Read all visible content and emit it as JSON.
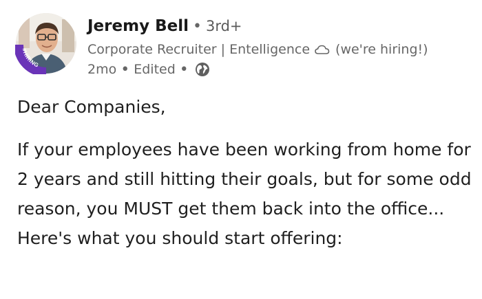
{
  "author": {
    "name": "Jeremy Bell",
    "degree": "3rd+",
    "headline": "Corporate Recruiter | Entelligence",
    "headline_suffix": "(we're hiring!)",
    "time": "2mo",
    "edited": "Edited",
    "avatar_badge": "#HIRING"
  },
  "post": {
    "greeting": "Dear Companies,",
    "paragraph": "If your employees have been working from home for 2 years and still hitting their goals, but for some odd reason, you MUST get them back into the office... Here's what you should start offering:"
  },
  "colors": {
    "hiring_ring": "#6a34b8",
    "text_primary": "#1f1f1f",
    "text_secondary": "#666666"
  },
  "icons": {
    "header_cloud": "cloud-icon",
    "visibility": "globe-icon"
  }
}
